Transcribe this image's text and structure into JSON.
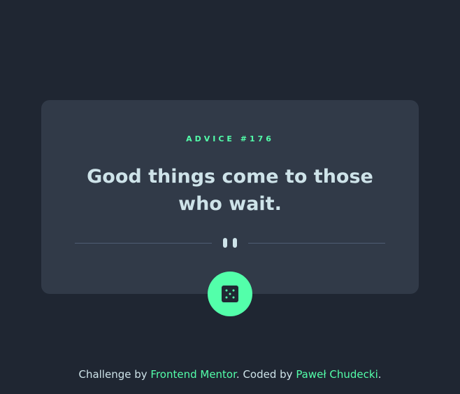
{
  "card": {
    "advice_label": "ADVICE #176",
    "advice_text": "Good things come to those who wait."
  },
  "dice_button": {
    "icon": "dice-icon"
  },
  "divider": {
    "icon": "pause-icon"
  },
  "footer": {
    "prefix": "Challenge by ",
    "link1": "Frontend Mentor",
    "middle": ". Coded by ",
    "link2": "Paweł Chudecki",
    "suffix": "."
  },
  "colors": {
    "background": "#1f2632",
    "card": "#313a48",
    "accent": "#53ffaa",
    "text": "#cee3e9",
    "divider": "#4f5d74"
  }
}
